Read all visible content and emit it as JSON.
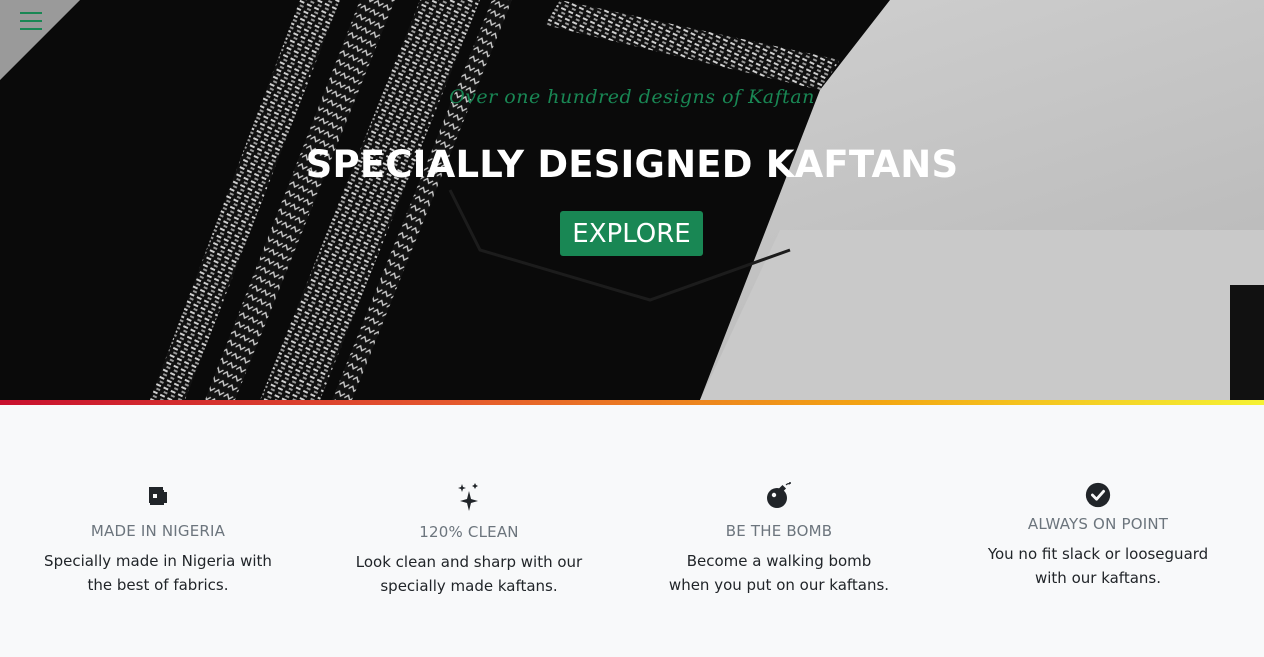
{
  "hero": {
    "tagline": "Over one hundred designs of Kaftan",
    "headline": "SPECIALLY DESIGNED KAFTANS",
    "explore_label": "EXPLORE"
  },
  "nav": {
    "menu_icon": "hamburger-menu-icon"
  },
  "colors": {
    "accent": "#198754",
    "stripe": [
      "#c8102e",
      "#e4572e",
      "#f3a712",
      "#f5f233"
    ],
    "feature_title": "#6c757d",
    "feature_text": "#212529",
    "section_bg": "#f8f9fa"
  },
  "features": [
    {
      "icon": "sewing-machine-icon",
      "title": "MADE IN NIGERIA",
      "line1": "Specially made in Nigeria with",
      "line2": "the best of fabrics."
    },
    {
      "icon": "sparkles-icon",
      "title": "120% CLEAN",
      "line1": "Look clean and sharp with our",
      "line2": "specially made kaftans."
    },
    {
      "icon": "bomb-icon",
      "title": "BE THE BOMB",
      "line1": "Become a walking bomb",
      "line2": "when you put on our kaftans."
    },
    {
      "icon": "check-circle-icon",
      "title": "ALWAYS ON POINT",
      "line1": "You no fit slack or looseguard",
      "line2": "with our kaftans."
    }
  ]
}
